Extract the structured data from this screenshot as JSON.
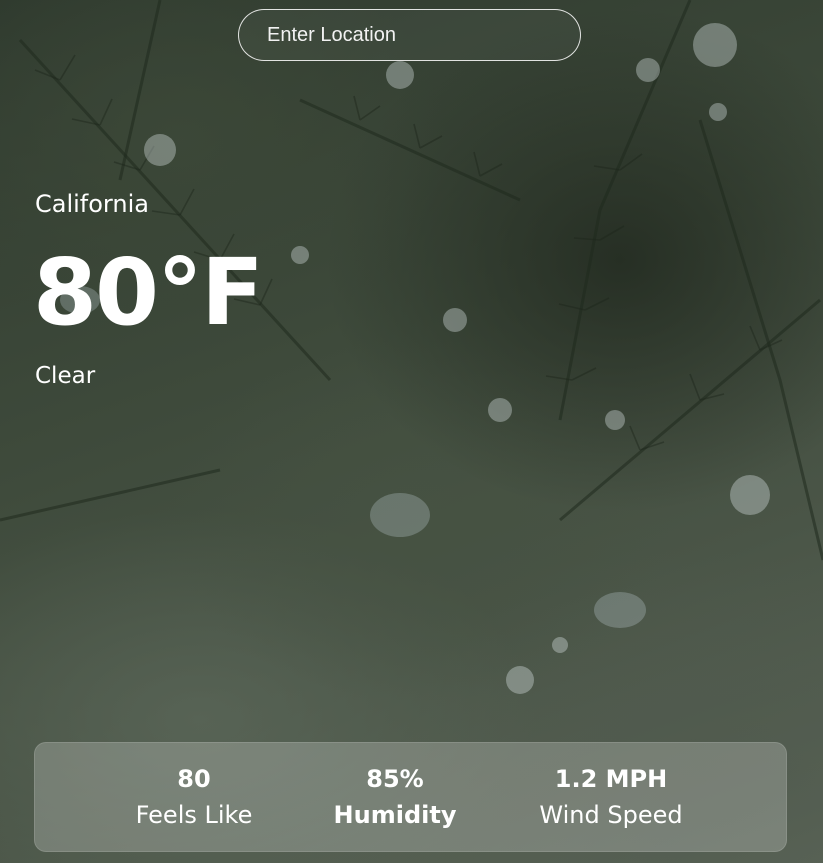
{
  "search": {
    "placeholder": "Enter Location",
    "value": ""
  },
  "current": {
    "location": "California",
    "temperature": "80°F",
    "condition": "Clear"
  },
  "stats": {
    "feels_like": {
      "value": "80",
      "label": "Feels Like"
    },
    "humidity": {
      "value": "85%",
      "label": "Humidity"
    },
    "wind_speed": {
      "value": "1.2 MPH",
      "label": "Wind Speed"
    }
  },
  "colors": {
    "text": "#ffffff",
    "panel": "rgba(255,255,255,0.22)",
    "background": "#3b4438"
  },
  "background_image": "rain-drops-on-pine-branches"
}
